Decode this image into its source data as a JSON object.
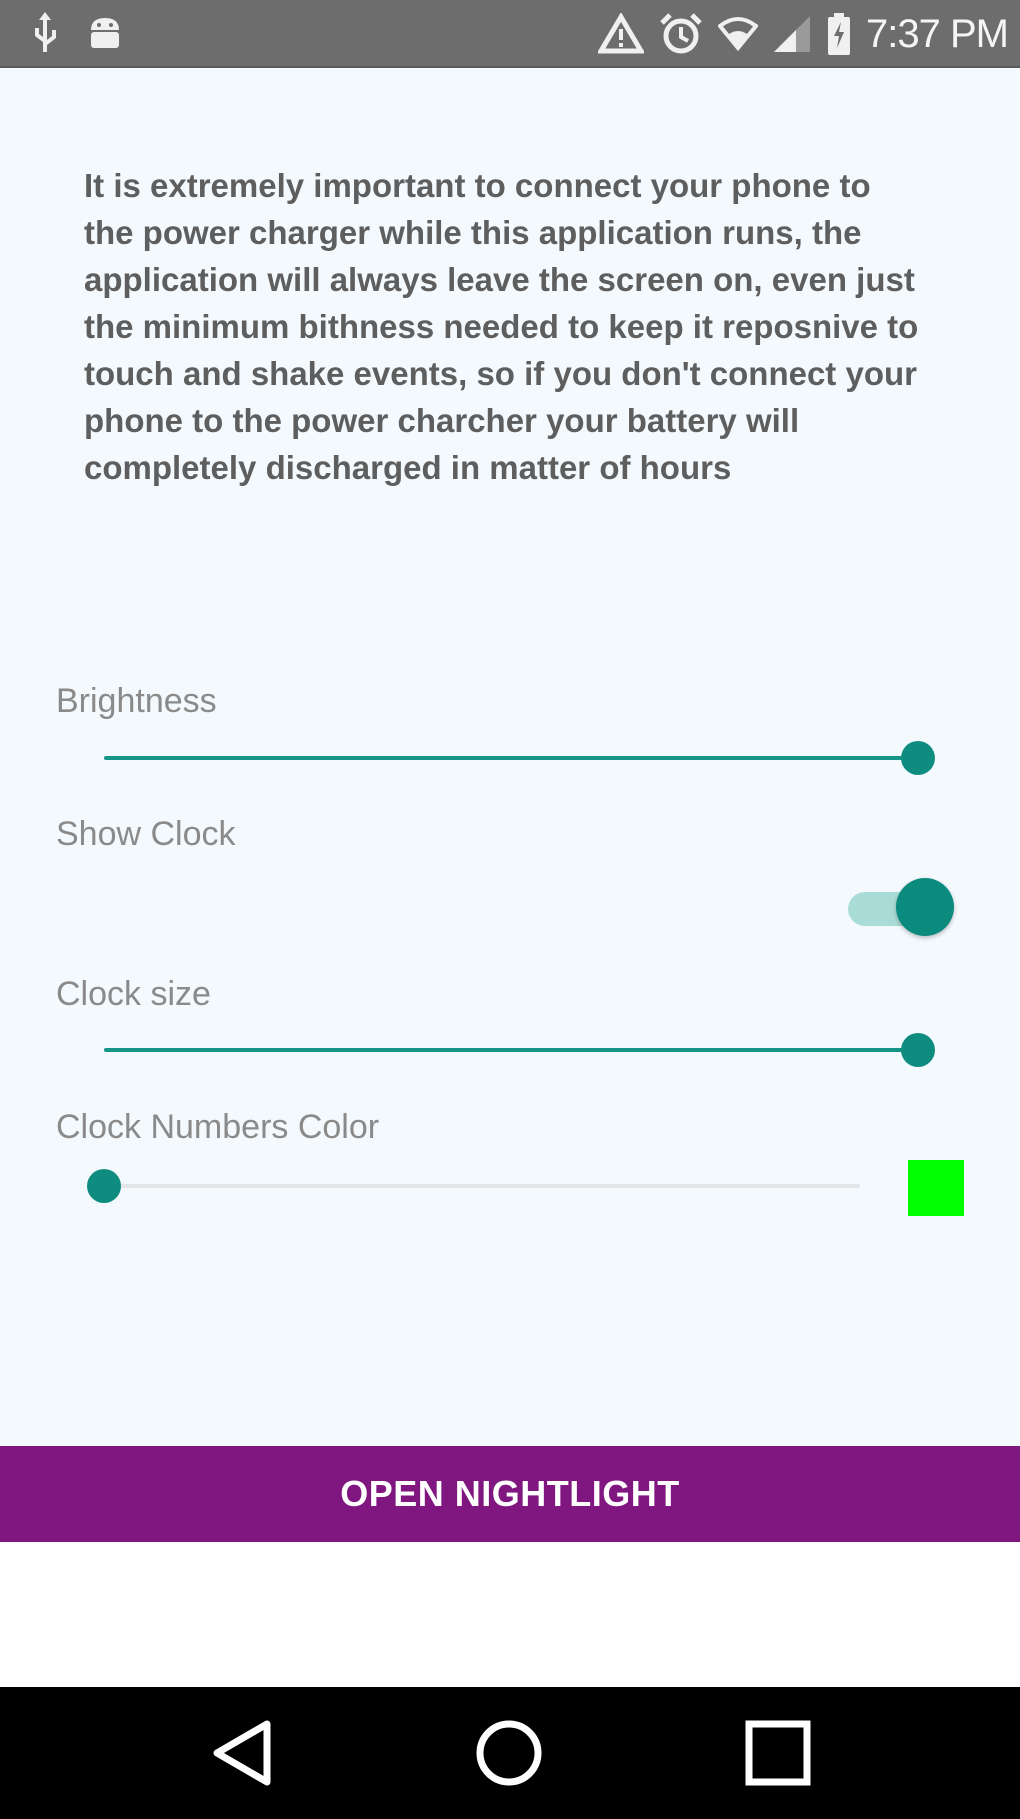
{
  "status_bar": {
    "time": "7:37 PM",
    "left_icons": [
      "usb-icon",
      "android-icon"
    ],
    "right_icons": [
      "warning-icon",
      "alarm-icon",
      "wifi-icon",
      "signal-icon",
      "battery-charging-icon"
    ]
  },
  "notice": {
    "text": "It is extremely important to connect  your phone to the power charger  while this application runs, the application will always leave the screen on, even just the minimum bithness needed to keep it reposnive to touch and shake events, so if you don't connect your phone to the power charcher your battery will completely discharged in matter of hours"
  },
  "settings": {
    "brightness": {
      "label": "Brightness",
      "value": 1.0
    },
    "show_clock": {
      "label": "Show Clock",
      "checked": true
    },
    "clock_size": {
      "label": "Clock size",
      "value": 1.0
    },
    "clock_numbers_color": {
      "label": "Clock Numbers Color",
      "value": 0.0,
      "color": "#00ff00"
    }
  },
  "actions": {
    "open_button_label": "OPEN NIGHTLIGHT"
  },
  "nav_bar": {
    "icons": [
      "back-icon",
      "home-icon",
      "recents-icon"
    ]
  },
  "colors": {
    "accent": "#0f8c80",
    "button": "#80167f",
    "background": "#f3f9fd"
  }
}
